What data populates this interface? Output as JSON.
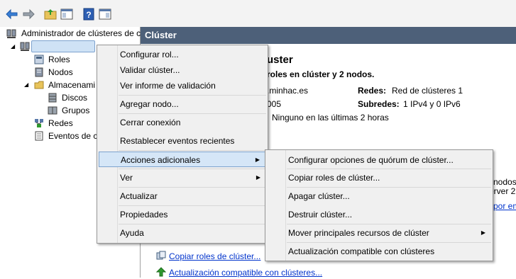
{
  "tree": {
    "root": "Administrador de clústeres de c",
    "items": [
      "Roles",
      "Nodos",
      "Almacenami",
      "Discos",
      "Grupos",
      "Redes",
      "Eventos de c"
    ]
  },
  "pane": {
    "header": "Clúster",
    "cluster_title": "uster",
    "summary": "roles en clúster y 2 nodos.",
    "domain": ".minhac.es",
    "version": "005",
    "events": "Ninguno en las últimas 2 horas",
    "redes_label": "Redes:",
    "redes_value": "Red de clústeres 1",
    "subredes_label": "Subredes:",
    "subredes_value": "1 IPv4 y 0 IPv6",
    "partial_1": "nodos",
    "partial_2": "erver 2(",
    "partial_3": "por em",
    "link_1": "Copiar roles de clúster...",
    "link_2": "Actualización compatible con clústeres..."
  },
  "context_menu": {
    "items": [
      "Configurar rol...",
      "Validar clúster...",
      "Ver informe de validación",
      "Agregar nodo...",
      "Cerrar conexión",
      "Restablecer eventos recientes",
      "Acciones adicionales",
      "Ver",
      "Actualizar",
      "Propiedades",
      "Ayuda"
    ]
  },
  "submenu": {
    "items": [
      "Configurar opciones de quórum de clúster...",
      "Copiar roles de clúster...",
      "Apagar clúster...",
      "Destruir clúster...",
      "Mover principales recursos de clúster",
      "Actualización compatible con clústeres"
    ]
  },
  "colors": {
    "header_bg": "#4d6079",
    "highlight": "#d5e6f7",
    "link": "#0033cc"
  }
}
